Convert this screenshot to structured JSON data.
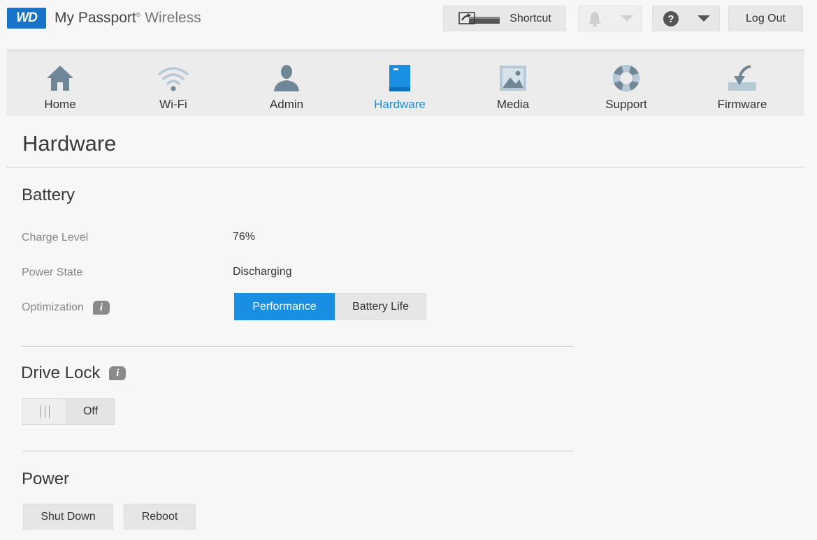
{
  "header": {
    "logo_text": "WD",
    "product_name": "My Passport",
    "product_suffix": "Wireless",
    "trademark": "®",
    "shortcut_label": "Shortcut",
    "logout_label": "Log Out"
  },
  "nav": {
    "items": [
      {
        "label": "Home",
        "icon": "home-icon"
      },
      {
        "label": "Wi-Fi",
        "icon": "wifi-icon"
      },
      {
        "label": "Admin",
        "icon": "admin-icon"
      },
      {
        "label": "Hardware",
        "icon": "hardware-icon"
      },
      {
        "label": "Media",
        "icon": "media-icon"
      },
      {
        "label": "Support",
        "icon": "support-icon"
      },
      {
        "label": "Firmware",
        "icon": "firmware-icon"
      }
    ],
    "active": "Hardware"
  },
  "page": {
    "title": "Hardware"
  },
  "battery": {
    "title": "Battery",
    "charge_label": "Charge Level",
    "charge_value": "76%",
    "state_label": "Power State",
    "state_value": "Discharging",
    "optimization_label": "Optimization",
    "option_performance": "Performance",
    "option_battery_life": "Battery Life",
    "selected_option": "Performance"
  },
  "drive_lock": {
    "title": "Drive Lock",
    "toggle_state": "Off"
  },
  "power": {
    "title": "Power",
    "shutdown_label": "Shut Down",
    "reboot_label": "Reboot"
  },
  "colors": {
    "accent": "#1a8ee1",
    "brand": "#1873c9",
    "icon_gray": "#6f8797"
  }
}
